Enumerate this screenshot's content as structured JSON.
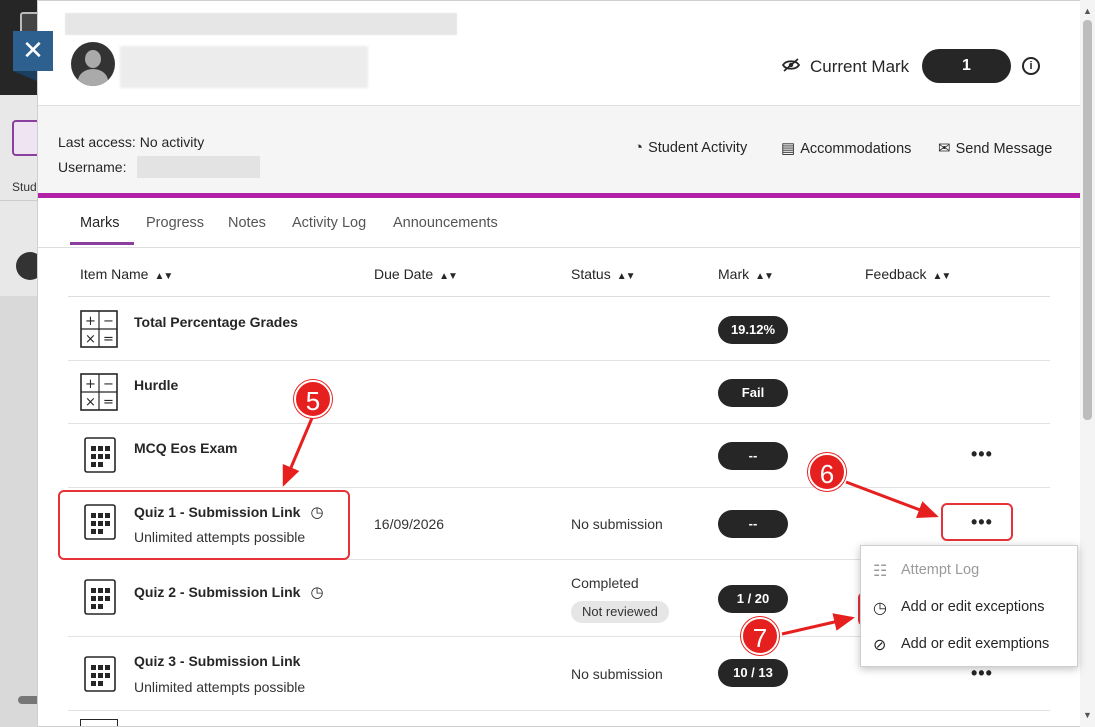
{
  "header": {
    "current_mark_label": "Current Mark",
    "current_mark_value": "1",
    "info_glyph": "i"
  },
  "info": {
    "last_access_label": "Last access:",
    "last_access_value": "No activity",
    "username_label": "Username:"
  },
  "actions": [
    {
      "label": "Student Activity",
      "icon": "activity-icon"
    },
    {
      "label": "Accommodations",
      "icon": "document-icon"
    },
    {
      "label": "Send Message",
      "icon": "envelope-icon"
    }
  ],
  "tabs": [
    "Marks",
    "Progress",
    "Notes",
    "Activity Log",
    "Announcements"
  ],
  "columns": [
    "Item Name",
    "Due Date",
    "Status",
    "Mark",
    "Feedback"
  ],
  "rows": [
    {
      "name": "Total Percentage Grades",
      "sub": "",
      "due": "",
      "status": "",
      "badge": "",
      "mark": "19.12%",
      "more": ""
    },
    {
      "name": "Hurdle",
      "sub": "",
      "due": "",
      "status": "",
      "badge": "",
      "mark": "Fail",
      "more": ""
    },
    {
      "name": "MCQ Eos Exam",
      "sub": "",
      "due": "",
      "status": "",
      "badge": "",
      "mark": "--",
      "more": "•••"
    },
    {
      "name": "Quiz 1 - Submission Link",
      "sub": "Unlimited attempts possible",
      "due": "16/09/2026",
      "status": "No submission",
      "badge": "",
      "mark": "--",
      "more": "•••"
    },
    {
      "name": "Quiz 2 - Submission Link",
      "sub": "",
      "due": "",
      "status": "Completed",
      "badge": "Not reviewed",
      "mark": "1 / 20",
      "more": ""
    },
    {
      "name": "Quiz 3 - Submission Link",
      "sub": "Unlimited attempts possible",
      "due": "",
      "status": "No submission",
      "badge": "",
      "mark": "10 / 13",
      "more": "•••"
    }
  ],
  "menu": [
    {
      "label": "Attempt Log",
      "icon": "list-icon",
      "disabled": true
    },
    {
      "label": "Add or edit exceptions",
      "icon": "clock-icon",
      "disabled": false
    },
    {
      "label": "Add or edit exemptions",
      "icon": "prohibit-icon",
      "disabled": false
    }
  ],
  "callouts": [
    "5",
    "6",
    "7"
  ],
  "colors": {
    "accent": "#b120a7",
    "callout": "#e6201f",
    "pill": "#262626"
  }
}
